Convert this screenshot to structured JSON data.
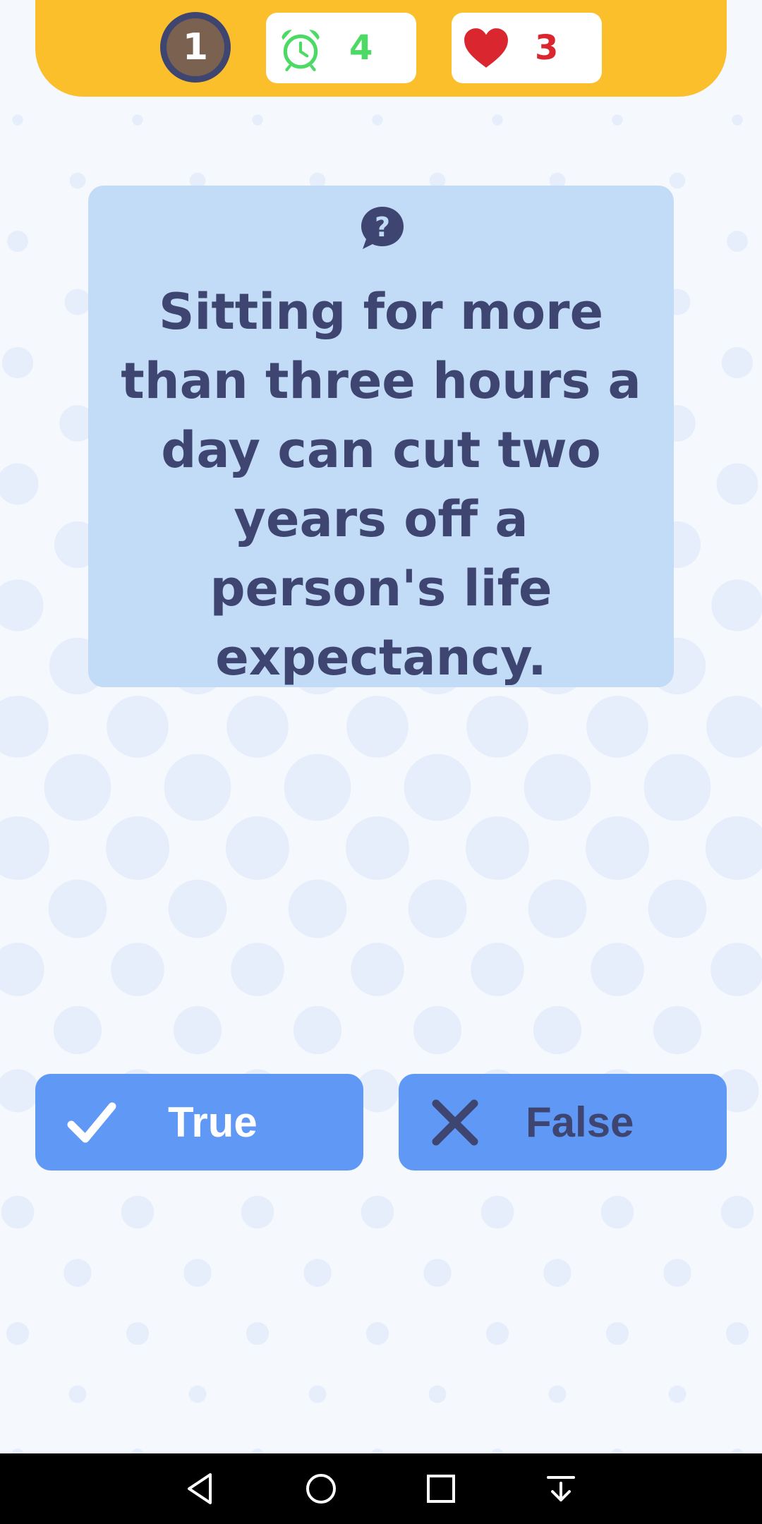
{
  "hud": {
    "level": "1",
    "timer": "4",
    "lives": "3"
  },
  "question": {
    "text": "Sitting for more than three hours a day can cut two years off a person's life expectancy."
  },
  "answers": {
    "true_label": "True",
    "false_label": "False"
  },
  "colors": {
    "background": "#f5f8fd",
    "topbar": "#fbbf2c",
    "card": "#c2dbf7",
    "button": "#5f98f5",
    "text_dark": "#3d4570",
    "timer_green": "#4cd964",
    "heart_red": "#d9262f",
    "level_badge": "#7a6150"
  },
  "icons": {
    "timer": "alarm-clock-icon",
    "lives": "heart-icon",
    "question": "question-bubble-icon",
    "true": "check-icon",
    "false": "x-icon"
  }
}
